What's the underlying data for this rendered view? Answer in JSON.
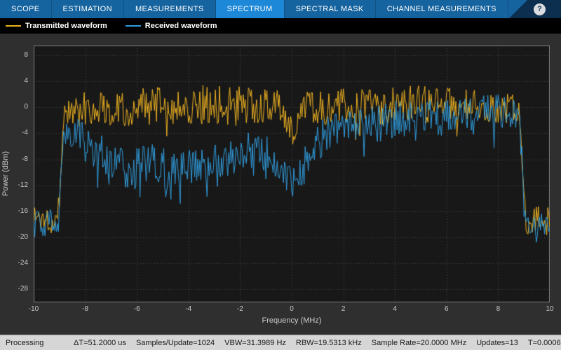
{
  "toolbar": {
    "tabs": [
      {
        "label": "SCOPE",
        "active": false
      },
      {
        "label": "ESTIMATION",
        "active": false
      },
      {
        "label": "MEASUREMENTS",
        "active": false
      },
      {
        "label": "SPECTRUM",
        "active": true
      },
      {
        "label": "SPECTRAL MASK",
        "active": false
      },
      {
        "label": "CHANNEL MEASUREMENTS",
        "active": false
      }
    ],
    "help_label": "?",
    "active_tab_color": "#1e88d8",
    "bar_color": "#15639f"
  },
  "legend": {
    "items": [
      {
        "label": "Transmitted waveform",
        "color": "#EDB120"
      },
      {
        "label": "Received waveform",
        "color": "#2F9BDC"
      }
    ]
  },
  "status_bar": {
    "state": "Processing",
    "items": [
      "ΔT=51.2000 us",
      "Samples/Update=1024",
      "VBW=31.3989 Hz",
      "RBW=19.5313 kHz",
      "Sample Rate=20.0000 MHz",
      "Updates=13",
      "T=0.0006"
    ]
  },
  "chart_data": {
    "type": "line",
    "title": "",
    "xlabel": "Frequency (MHz)",
    "ylabel": "Power (dBm)",
    "xlim": [
      -10,
      10
    ],
    "ylim": [
      -30,
      9.5
    ],
    "xticks": [
      -10,
      -8,
      -6,
      -4,
      -2,
      0,
      2,
      4,
      6,
      8,
      10
    ],
    "yticks": [
      8,
      4,
      0,
      -4,
      -8,
      -12,
      -16,
      -20,
      -24,
      -28
    ],
    "grid": true,
    "legend_position": "top-left-outside",
    "plot_bg": "#181818",
    "grid_color": "#4a4a4a",
    "border_color": "#7d7d7d",
    "noise_seed": 1337,
    "sample_step": 0.04,
    "series": [
      {
        "name": "Transmitted waveform",
        "color": "#EDB120",
        "spike_prob": 0.05,
        "spike_depth": 4,
        "envelope": [
          [
            -10,
            -17,
            2.5
          ],
          [
            -9.05,
            -17,
            2.5
          ],
          [
            -8.85,
            -1,
            2.5
          ],
          [
            -8,
            0,
            2.8
          ],
          [
            -6,
            0,
            3
          ],
          [
            -4,
            0.3,
            3
          ],
          [
            -2.5,
            0.5,
            3.2
          ],
          [
            -0.4,
            0,
            2.5
          ],
          [
            0.1,
            -4.5,
            2.5
          ],
          [
            0.5,
            0,
            2.5
          ],
          [
            2,
            0.2,
            2.8
          ],
          [
            4,
            0.3,
            3
          ],
          [
            6,
            0.3,
            3
          ],
          [
            8,
            0,
            2.5
          ],
          [
            8.85,
            -0.5,
            2.5
          ],
          [
            9.05,
            -17,
            2.5
          ],
          [
            10,
            -17.5,
            2.5
          ]
        ]
      },
      {
        "name": "Received waveform",
        "color": "#2F9BDC",
        "spike_prob": 0.09,
        "spike_depth": 4.5,
        "envelope": [
          [
            -10,
            -18,
            2
          ],
          [
            -9.05,
            -17.5,
            2
          ],
          [
            -8.85,
            -4.5,
            2.5
          ],
          [
            -8.2,
            -4,
            2.5
          ],
          [
            -7.6,
            -6.5,
            3
          ],
          [
            -7,
            -8.5,
            3
          ],
          [
            -6.2,
            -9.5,
            3.5
          ],
          [
            -5.4,
            -8.5,
            3
          ],
          [
            -4.6,
            -10,
            3.5
          ],
          [
            -3.8,
            -9.5,
            3
          ],
          [
            -3,
            -8.5,
            3
          ],
          [
            -2.2,
            -7.5,
            3
          ],
          [
            -1.4,
            -6.5,
            3
          ],
          [
            -0.8,
            -7.5,
            3
          ],
          [
            -0.3,
            -10.5,
            2.5
          ],
          [
            0.2,
            -11.5,
            2.5
          ],
          [
            0.6,
            -8,
            3
          ],
          [
            1.2,
            -4.5,
            3
          ],
          [
            2,
            -3,
            2.5
          ],
          [
            3,
            -2.5,
            3
          ],
          [
            4,
            -2,
            3
          ],
          [
            5,
            -1.5,
            2.5
          ],
          [
            6,
            -1,
            2.5
          ],
          [
            7,
            -0.8,
            2.5
          ],
          [
            8,
            -0.5,
            2.5
          ],
          [
            8.85,
            -1.5,
            2.5
          ],
          [
            9.05,
            -17.5,
            2
          ],
          [
            10,
            -18.5,
            2
          ]
        ]
      }
    ]
  }
}
